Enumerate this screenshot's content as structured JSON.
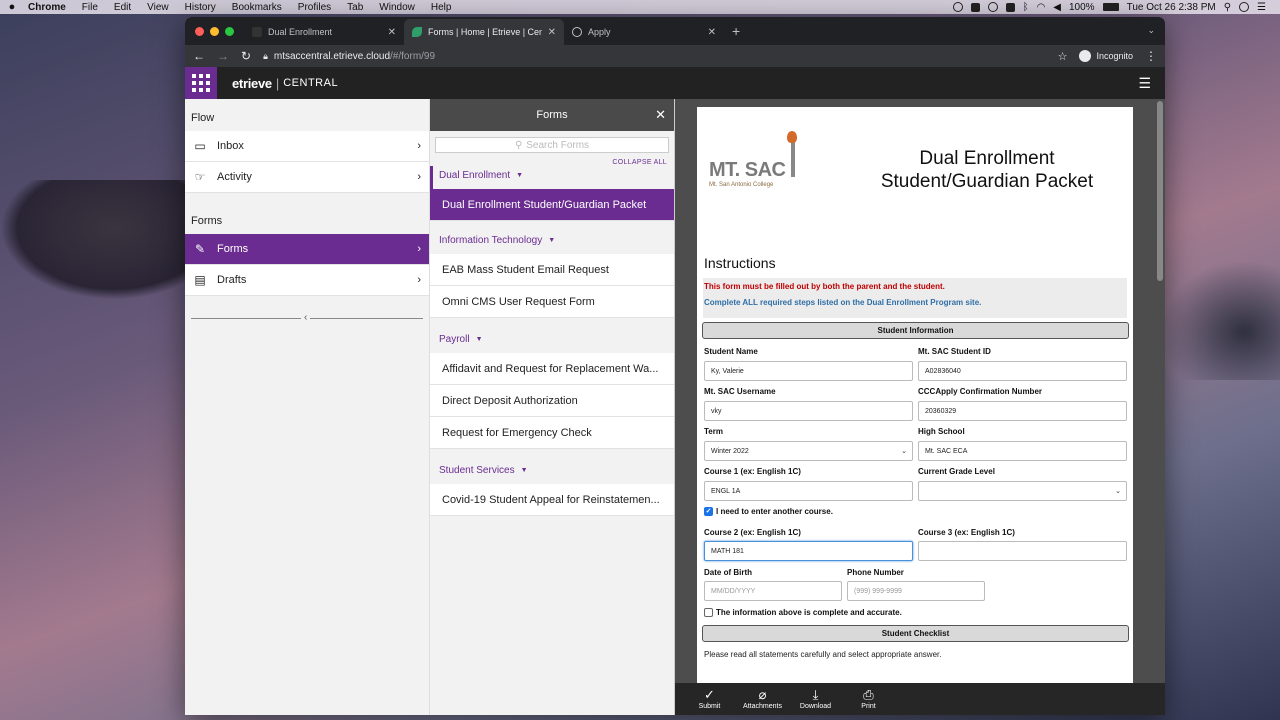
{
  "menubar": {
    "app": "Chrome",
    "items": [
      "File",
      "Edit",
      "View",
      "History",
      "Bookmarks",
      "Profiles",
      "Tab",
      "Window",
      "Help"
    ],
    "battery": "100%",
    "datetime": "Tue Oct 26  2:38 PM"
  },
  "browser": {
    "tabs": [
      {
        "label": "Dual Enrollment"
      },
      {
        "label": "Forms | Home | Etrieve | Centr..."
      },
      {
        "label": "Apply"
      }
    ],
    "url_host": "mtsaccentral.etrieve.cloud",
    "url_path": "/#/form/99",
    "profile": "Incognito"
  },
  "app": {
    "brand": "etrieve",
    "product": "CENTRAL"
  },
  "leftnav": {
    "flow_label": "Flow",
    "flow_items": [
      {
        "label": "Inbox",
        "icon": "inbox-icon"
      },
      {
        "label": "Activity",
        "icon": "activity-icon"
      }
    ],
    "forms_label": "Forms",
    "forms_items": [
      {
        "label": "Forms",
        "icon": "pencil-icon"
      },
      {
        "label": "Drafts",
        "icon": "document-icon"
      }
    ]
  },
  "formspanel": {
    "title": "Forms",
    "search_placeholder": "Search Forms",
    "collapse_all": "COLLAPSE ALL",
    "groups": [
      {
        "label": "Dual Enrollment",
        "items": [
          "Dual Enrollment Student/Guardian Packet"
        ]
      },
      {
        "label": "Information Technology",
        "items": [
          "EAB Mass Student Email Request",
          "Omni CMS User Request Form"
        ]
      },
      {
        "label": "Payroll",
        "items": [
          "Affidavit and Request for Replacement Wa...",
          "Direct Deposit Authorization",
          "Request for Emergency Check"
        ]
      },
      {
        "label": "Student Services",
        "items": [
          "Covid-19 Student Appeal for Reinstatemen..."
        ]
      }
    ]
  },
  "document": {
    "logo_text": "MT. SAC",
    "logo_subtext": "Mt. San Antonio College",
    "title": "Dual Enrollment Student/Guardian Packet",
    "instructions_heading": "Instructions",
    "notice_red": "This form must be filled out by both the parent and the student.",
    "notice_blue": "Complete ALL required steps listed on the Dual Enrollment Program site.",
    "section_student_info": "Student Information",
    "fields": {
      "student_name": {
        "label": "Student Name",
        "value": "Ky, Valerie"
      },
      "student_id": {
        "label": "Mt. SAC Student ID",
        "value": "A02836040"
      },
      "username": {
        "label": "Mt. SAC Username",
        "value": "vky"
      },
      "cccapply": {
        "label": "CCCApply Confirmation Number",
        "value": "20360329"
      },
      "term": {
        "label": "Term",
        "value": "Winter 2022"
      },
      "high_school": {
        "label": "High School",
        "value": "Mt. SAC ECA"
      },
      "course1": {
        "label": "Course 1 (ex: English 1C)",
        "value": "ENGL 1A"
      },
      "grade_level": {
        "label": "Current Grade Level",
        "value": ""
      },
      "course2": {
        "label": "Course 2 (ex: English 1C)",
        "value": "MATH 181"
      },
      "course3": {
        "label": "Course 3 (ex: English 1C)",
        "value": ""
      },
      "dob": {
        "label": "Date of Birth",
        "placeholder": "MM/DD/YYYY"
      },
      "phone": {
        "label": "Phone Number",
        "placeholder": "(999) 999-9999"
      }
    },
    "checkbox_another_course": "I need to enter another course.",
    "checkbox_accurate": "The information above is complete and accurate.",
    "section_checklist": "Student Checklist",
    "checklist_intro": "Please read all statements carefully and select appropriate answer."
  },
  "actions": [
    {
      "label": "Submit",
      "icon": "checkmark-icon"
    },
    {
      "label": "Attachments",
      "icon": "paperclip-icon"
    },
    {
      "label": "Download",
      "icon": "download-icon"
    },
    {
      "label": "Print",
      "icon": "printer-icon"
    }
  ]
}
